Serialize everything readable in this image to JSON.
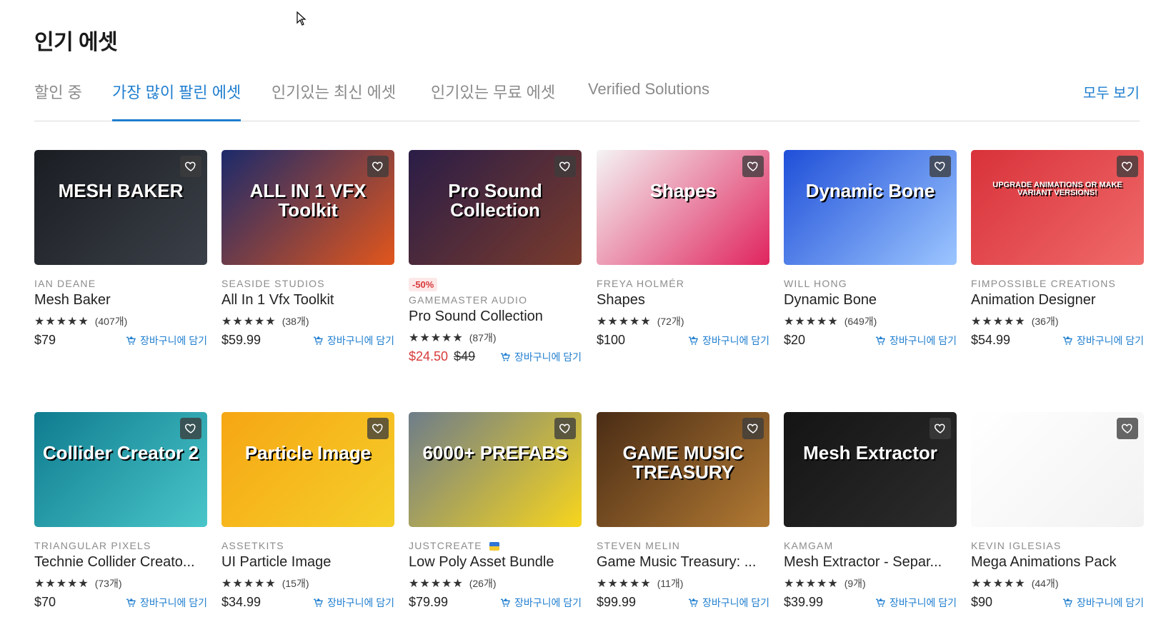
{
  "page": {
    "title": "인기 에셋"
  },
  "tabs": [
    {
      "label": "할인 중",
      "active": false
    },
    {
      "label": "가장 많이 팔린 에셋",
      "active": true
    },
    {
      "label": "인기있는 최신 에셋",
      "active": false
    },
    {
      "label": "인기있는 무료 에셋",
      "active": false
    },
    {
      "label": "Verified Solutions",
      "active": false
    }
  ],
  "view_all": "모두 보기",
  "cart_label": "장바구니에 담기",
  "stars": "★★★★★",
  "assets": [
    {
      "publisher": "IAN DEANE",
      "title": "Mesh Baker",
      "reviews": "(407개)",
      "price": "$79",
      "thumb_text": "MESH BAKER",
      "colors": [
        "#1a1d22",
        "#3b4048"
      ]
    },
    {
      "publisher": "SEASIDE STUDIOS",
      "title": "All In 1 Vfx Toolkit",
      "reviews": "(38개)",
      "price": "$59.99",
      "thumb_text": "ALL IN 1 VFX Toolkit",
      "colors": [
        "#1b2a6b",
        "#e2561c"
      ]
    },
    {
      "discount": "-50%",
      "publisher": "GAMEMASTER AUDIO",
      "title": "Pro Sound Collection",
      "reviews": "(87개)",
      "price": "$24.50",
      "original_price": "$49",
      "thumb_text": "Pro Sound Collection",
      "colors": [
        "#2a1d47",
        "#7a3b2c"
      ]
    },
    {
      "publisher": "FREYA HOLMÉR",
      "title": "Shapes",
      "reviews": "(72개)",
      "price": "$100",
      "thumb_text": "Shapes",
      "colors": [
        "#f4f4f4",
        "#e0245e"
      ]
    },
    {
      "publisher": "WILL HONG",
      "title": "Dynamic Bone",
      "reviews": "(649개)",
      "price": "$20",
      "thumb_text": "Dynamic Bone",
      "colors": [
        "#1f4fd8",
        "#9cc6ff"
      ]
    },
    {
      "publisher": "FIMPOSSIBLE CREATIONS",
      "title": "Animation Designer",
      "reviews": "(36개)",
      "price": "$54.99",
      "thumb_text": "UPGRADE ANIMATIONS OR MAKE VARIANT VERSIONS!",
      "colors": [
        "#d8323a",
        "#f06a6a"
      ]
    },
    {
      "publisher": "TRIANGULAR PIXELS",
      "title": "Technie Collider Creato...",
      "reviews": "(73개)",
      "price": "$70",
      "thumb_text": "Collider Creator 2",
      "colors": [
        "#0f7c8f",
        "#49c6c9"
      ]
    },
    {
      "publisher": "ASSETKITS",
      "title": "UI Particle Image",
      "reviews": "(15개)",
      "price": "$34.99",
      "thumb_text": "Particle Image",
      "colors": [
        "#f6a613",
        "#f5cf2a"
      ]
    },
    {
      "publisher": "JUSTCREATE",
      "title": "Low Poly Asset Bundle",
      "reviews": "(26개)",
      "price": "$79.99",
      "thumb_text": "6000+ PREFABS",
      "colors": [
        "#6e7d8a",
        "#f7d51d"
      ]
    },
    {
      "publisher": "STEVEN MELIN",
      "title": "Game Music Treasury: ...",
      "reviews": "(11개)",
      "price": "$99.99",
      "thumb_text": "GAME MUSIC TREASURY",
      "colors": [
        "#4a2c15",
        "#b27a33"
      ]
    },
    {
      "publisher": "KAMGAM",
      "title": "Mesh Extractor - Separ...",
      "reviews": "(9개)",
      "price": "$39.99",
      "thumb_text": "Mesh Extractor",
      "colors": [
        "#141414",
        "#2c2c2c"
      ]
    },
    {
      "publisher": "KEVIN IGLESIAS",
      "title": "Mega Animations Pack",
      "reviews": "(44개)",
      "price": "$90",
      "thumb_text": "",
      "colors": [
        "#ffffff",
        "#f2f2f2"
      ]
    }
  ]
}
